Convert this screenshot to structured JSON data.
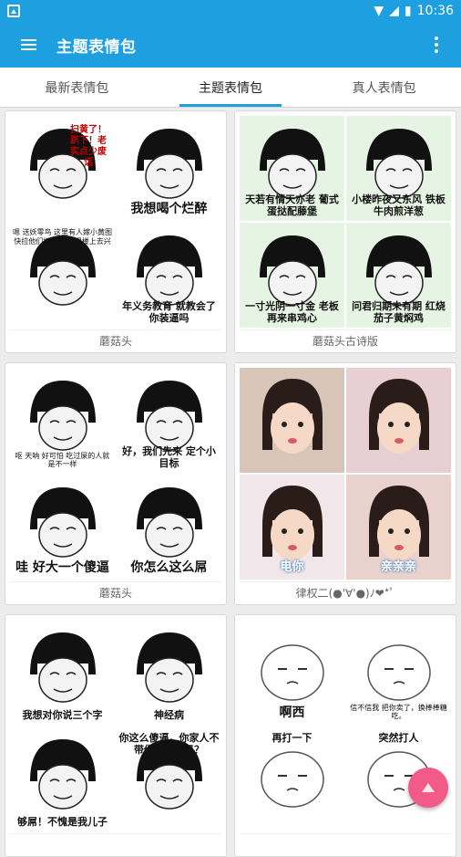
{
  "status_bar": {
    "time": "10:36"
  },
  "app_bar": {
    "title": "主题表情包"
  },
  "tabs": [
    {
      "label": "最新表情包",
      "active": false
    },
    {
      "label": "主题表情包",
      "active": true
    },
    {
      "label": "真人表情包",
      "active": false
    }
  ],
  "cards": [
    {
      "title": "蘑菇头",
      "kind": "mushroom",
      "bg": [
        "#ffffff",
        "#ffffff",
        "#ffffff",
        "#ffffff"
      ],
      "texts": [
        [
          "扫黄了！趴下！老实点少废话",
          "topright"
        ],
        [
          "我想喝个烂醉",
          "big"
        ],
        [
          "嗯 送妖零鸟 这里有人嫁小黄图 快拉他们抓起来 还得楼上去兴奋",
          "small top"
        ],
        [
          "年义务教育 就教会了你装逼吗",
          ""
        ]
      ]
    },
    {
      "title": "蘑菇头古诗版",
      "kind": "mushroom",
      "bg": [
        "#e6f5e3",
        "#e6f5e3",
        "#e6f5e3",
        "#e6f5e3"
      ],
      "texts": [
        [
          "天若有情天亦老 葡式蛋挞配藤堡",
          ""
        ],
        [
          "小楼昨夜又东风 铁板牛肉煎洋葱",
          ""
        ],
        [
          "一寸光阴一寸金 老板再来串鸡心",
          ""
        ],
        [
          "问君归期未有期 红烧茄子黄焖鸡",
          ""
        ]
      ]
    },
    {
      "title": "蘑菇头",
      "kind": "mushroom",
      "bg": [
        "#ffffff",
        "#ffffff",
        "#ffffff",
        "#ffffff"
      ],
      "texts": [
        [
          "",
          ""
        ],
        [
          "",
          ""
        ],
        [
          "呕 天呐 好可怕 吃过屎的人就是不一样",
          "small"
        ],
        [
          "好，我们先来 定个小目标",
          ""
        ],
        [
          "哇 好大一个傻逼",
          "big"
        ],
        [
          "你怎么这么屌",
          "big"
        ]
      ]
    },
    {
      "title": "律权二(●'∀'●)ﾉ❤*ﾟ",
      "kind": "photo",
      "bg": [
        "#d8c5b8",
        "#e7cfd3",
        "#f1e6ea",
        "#e9d2cd"
      ],
      "texts": [
        [
          "",
          ""
        ],
        [
          "",
          ""
        ],
        [
          "电你",
          ""
        ],
        [
          "亲亲亲",
          ""
        ]
      ]
    },
    {
      "title": "",
      "kind": "mushroom",
      "bg": [
        "#ffffff",
        "#ffffff",
        "#ffffff",
        "#ffffff"
      ],
      "texts": [
        [
          "我想对你说三个字",
          ""
        ],
        [
          "神经病",
          ""
        ],
        [
          "够屌！不愧是我儿子",
          ""
        ],
        [
          "你这么傻逼，你家人不带你去治疗吗？",
          "top"
        ]
      ]
    },
    {
      "title": "",
      "kind": "sketch",
      "bg": [
        "#ffffff",
        "#ffffff",
        "#ffffff",
        "#ffffff"
      ],
      "texts": [
        [
          "啊西",
          "big"
        ],
        [
          "信不信我 把你卖了，换棒棒糖吃。",
          "small"
        ],
        [
          "再打一下",
          "top"
        ],
        [
          "突然打人",
          "top"
        ]
      ]
    }
  ]
}
